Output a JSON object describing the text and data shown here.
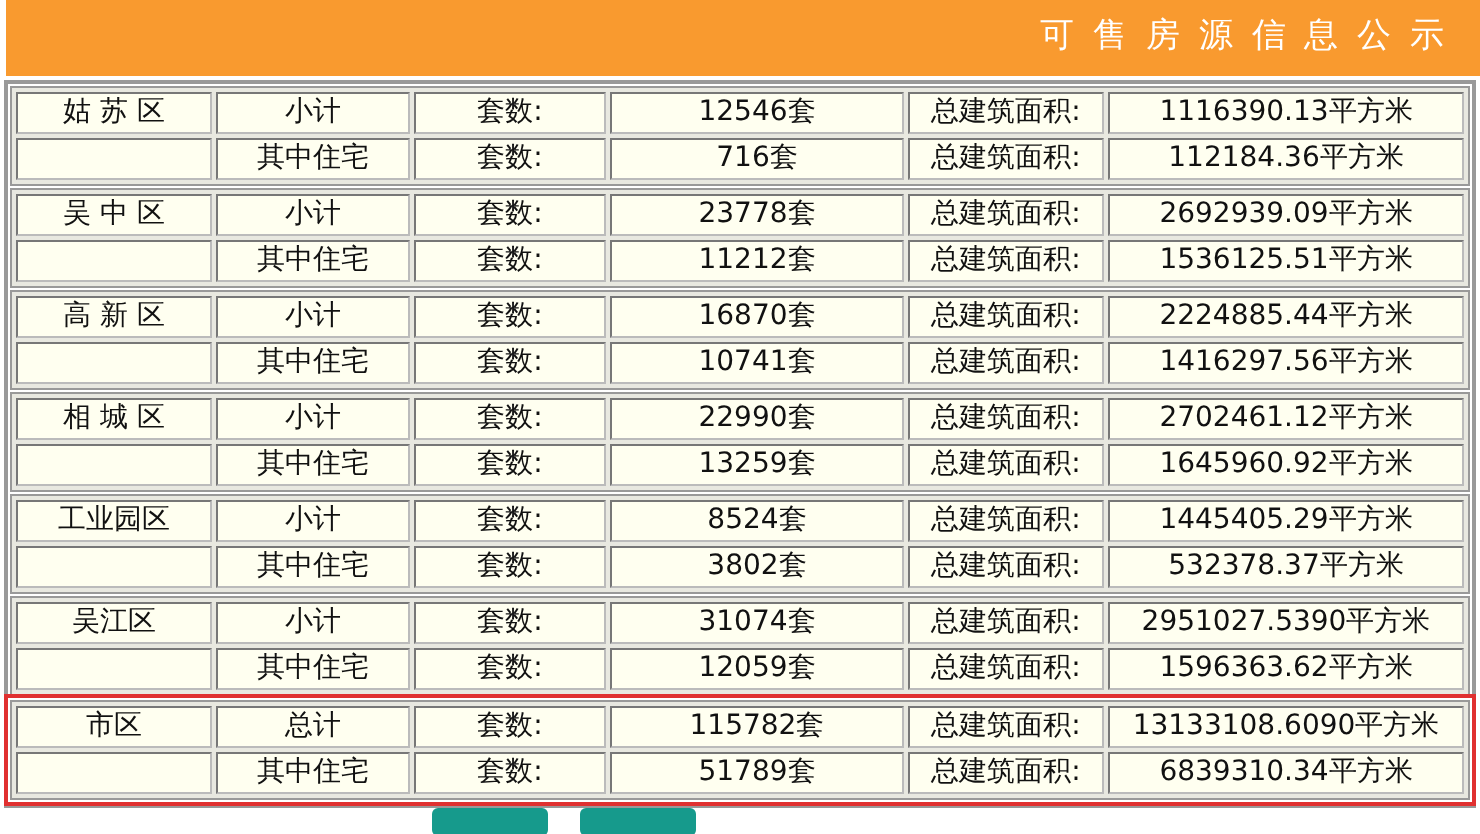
{
  "header": {
    "title": "可 售 房 源 信 息 公 示"
  },
  "groups": [
    {
      "district": "姑 苏 区",
      "highlighted": false,
      "rows": [
        {
          "category": "小计",
          "units_label": "套数:",
          "units": "12546套",
          "area_label": "总建筑面积:",
          "area": "1116390.13平方米"
        },
        {
          "category": "其中住宅",
          "units_label": "套数:",
          "units": "716套",
          "area_label": "总建筑面积:",
          "area": "112184.36平方米"
        }
      ]
    },
    {
      "district": "吴 中 区",
      "highlighted": false,
      "rows": [
        {
          "category": "小计",
          "units_label": "套数:",
          "units": "23778套",
          "area_label": "总建筑面积:",
          "area": "2692939.09平方米"
        },
        {
          "category": "其中住宅",
          "units_label": "套数:",
          "units": "11212套",
          "area_label": "总建筑面积:",
          "area": "1536125.51平方米"
        }
      ]
    },
    {
      "district": "高 新 区",
      "highlighted": false,
      "rows": [
        {
          "category": "小计",
          "units_label": "套数:",
          "units": "16870套",
          "area_label": "总建筑面积:",
          "area": "2224885.44平方米"
        },
        {
          "category": "其中住宅",
          "units_label": "套数:",
          "units": "10741套",
          "area_label": "总建筑面积:",
          "area": "1416297.56平方米"
        }
      ]
    },
    {
      "district": "相 城 区",
      "highlighted": false,
      "rows": [
        {
          "category": "小计",
          "units_label": "套数:",
          "units": "22990套",
          "area_label": "总建筑面积:",
          "area": "2702461.12平方米"
        },
        {
          "category": "其中住宅",
          "units_label": "套数:",
          "units": "13259套",
          "area_label": "总建筑面积:",
          "area": "1645960.92平方米"
        }
      ]
    },
    {
      "district": "工业园区",
      "highlighted": false,
      "rows": [
        {
          "category": "小计",
          "units_label": "套数:",
          "units": "8524套",
          "area_label": "总建筑面积:",
          "area": "1445405.29平方米"
        },
        {
          "category": "其中住宅",
          "units_label": "套数:",
          "units": "3802套",
          "area_label": "总建筑面积:",
          "area": "532378.37平方米"
        }
      ]
    },
    {
      "district": "吴江区",
      "highlighted": false,
      "rows": [
        {
          "category": "小计",
          "units_label": "套数:",
          "units": "31074套",
          "area_label": "总建筑面积:",
          "area": "2951027.5390平方米"
        },
        {
          "category": "其中住宅",
          "units_label": "套数:",
          "units": "12059套",
          "area_label": "总建筑面积:",
          "area": "1596363.62平方米"
        }
      ]
    },
    {
      "district": "市区",
      "highlighted": true,
      "rows": [
        {
          "category": "总计",
          "units_label": "套数:",
          "units": "115782套",
          "area_label": "总建筑面积:",
          "area": "13133108.6090平方米"
        },
        {
          "category": "其中住宅",
          "units_label": "套数:",
          "units": "51789套",
          "area_label": "总建筑面积:",
          "area": "6839310.34平方米"
        }
      ]
    }
  ],
  "bottom_buttons": [
    {
      "kind": "button"
    },
    {
      "kind": "button"
    }
  ]
}
